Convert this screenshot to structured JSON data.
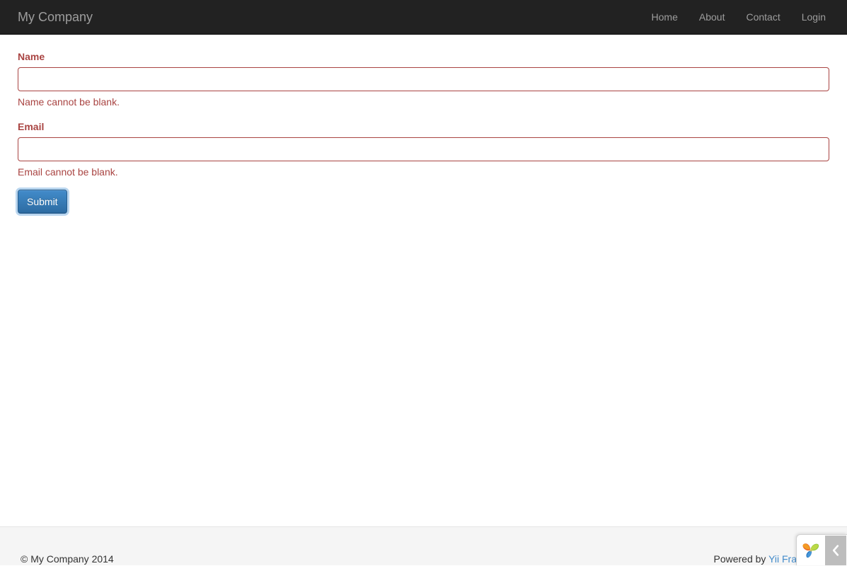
{
  "navbar": {
    "brand": "My Company",
    "links": [
      {
        "label": "Home"
      },
      {
        "label": "About"
      },
      {
        "label": "Contact"
      },
      {
        "label": "Login"
      }
    ]
  },
  "form": {
    "fields": [
      {
        "label": "Name",
        "value": "",
        "placeholder": "",
        "error": "Name cannot be blank."
      },
      {
        "label": "Email",
        "value": "",
        "placeholder": "",
        "error": "Email cannot be blank."
      }
    ],
    "submit_label": "Submit"
  },
  "footer": {
    "copyright": "© My Company 2014",
    "powered_by_prefix": "Powered by ",
    "powered_by_link": "Yii Framework"
  },
  "debug_toolbar": {
    "logo_icon": "yii-logo-icon",
    "toggle_icon": "chevron-left-icon",
    "toggle_label": "‹"
  },
  "colors": {
    "navbar_bg": "#222222",
    "navbar_text": "#9d9d9d",
    "error_red": "#a94442",
    "link_blue": "#428bca",
    "button_blue": "#3276b1",
    "footer_bg": "#f5f5f5"
  }
}
